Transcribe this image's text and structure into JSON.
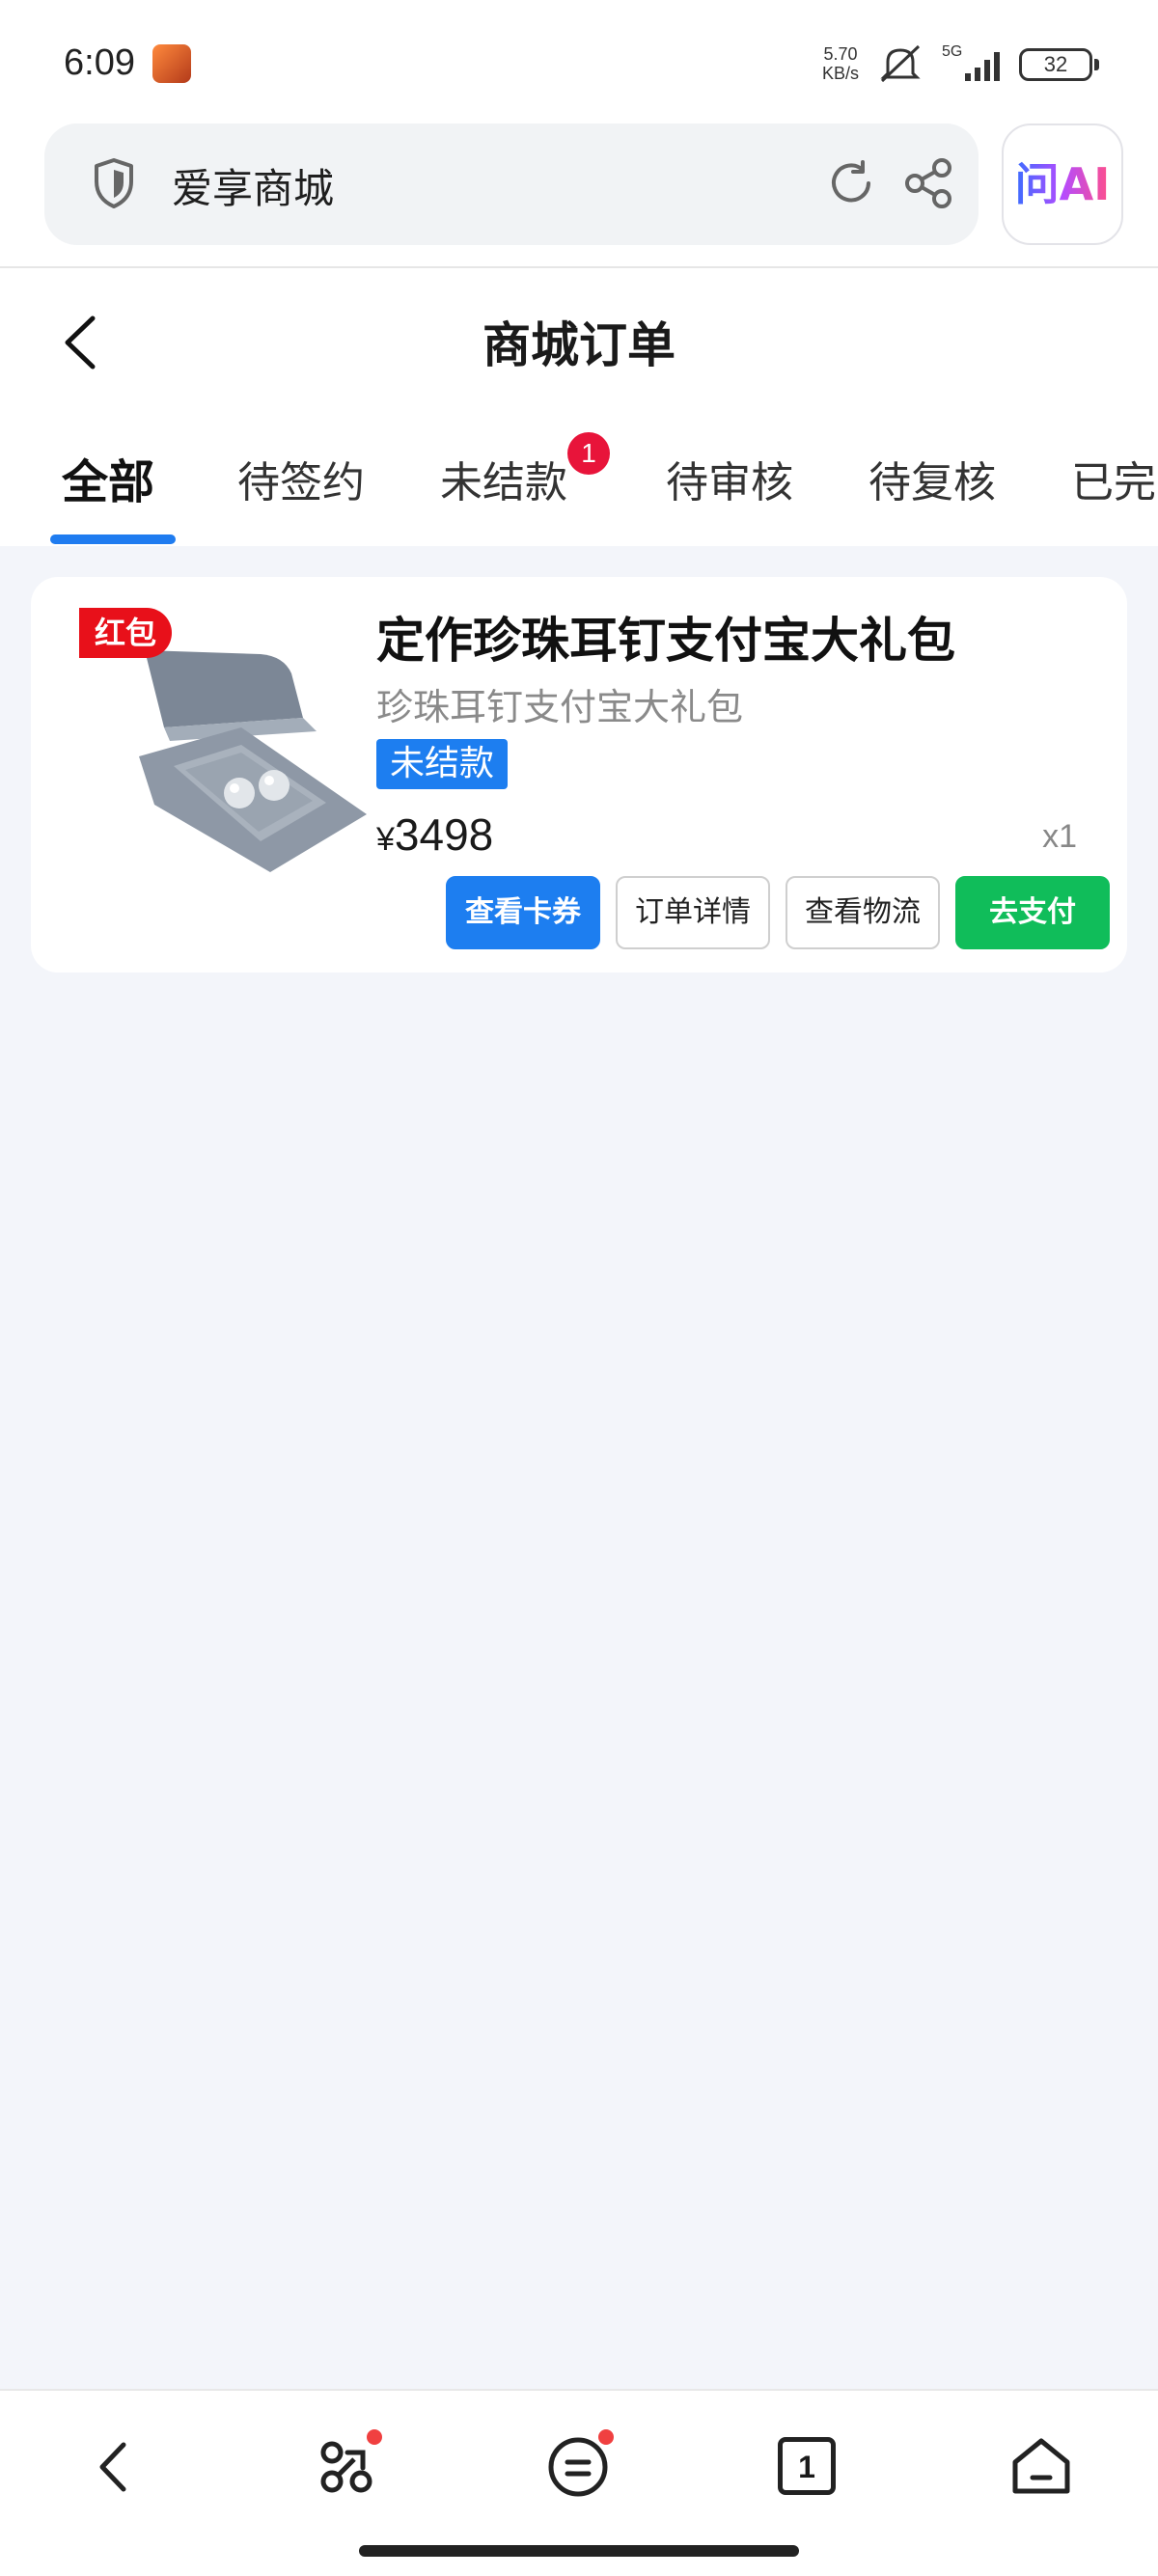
{
  "status_bar": {
    "time": "6:09",
    "speed_value": "5.70",
    "speed_unit": "KB/s",
    "network": "5G",
    "battery": "32"
  },
  "browser": {
    "url_title": "爱享商城",
    "ai_button_label": "问AI",
    "icons": [
      "shield-icon",
      "reload-icon",
      "share-icon"
    ]
  },
  "header": {
    "title": "商城订单"
  },
  "tabs": [
    {
      "label": "全部",
      "active": true
    },
    {
      "label": "待签约",
      "active": false
    },
    {
      "label": "未结款",
      "active": false,
      "badge": "1"
    },
    {
      "label": "待审核",
      "active": false
    },
    {
      "label": "待复核",
      "active": false
    },
    {
      "label": "已完",
      "active": false
    }
  ],
  "order": {
    "tag": "红包",
    "title": "定作珍珠耳钉支付宝大礼包",
    "subtitle": "珍珠耳钉支付宝大礼包",
    "status": "未结款",
    "currency": "¥",
    "price": "3498",
    "quantity": "x1",
    "buttons": {
      "view_coupon": "查看卡券",
      "order_detail": "订单详情",
      "view_logistics": "查看物流",
      "pay": "去支付"
    }
  },
  "colors": {
    "accent_blue": "#1d7ef0",
    "pay_green": "#10bd5a",
    "badge_red": "#e8143a"
  },
  "bottom_nav": [
    "back-icon",
    "shortcuts-icon",
    "menu-icon",
    "tabs-icon",
    "home-icon"
  ],
  "bottom_nav_tabs_count": "1"
}
